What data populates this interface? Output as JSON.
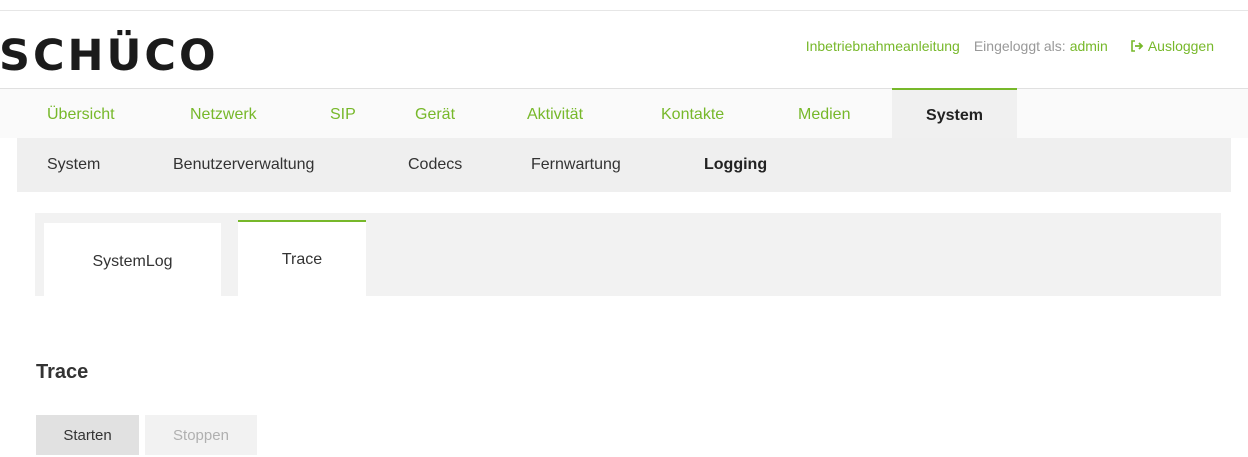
{
  "brand": {
    "logo_text": "SCHÜCO"
  },
  "header": {
    "guide_link": "Inbetriebnahmeanleitung",
    "logged_in_label": "Eingeloggt als:",
    "username": "admin",
    "logout_label": "Ausloggen",
    "logout_icon": "sign-out-icon"
  },
  "mainnav": {
    "items": [
      {
        "label": "Übersicht"
      },
      {
        "label": "Netzwerk"
      },
      {
        "label": "SIP"
      },
      {
        "label": "Gerät"
      },
      {
        "label": "Aktivität"
      },
      {
        "label": "Kontakte"
      },
      {
        "label": "Medien"
      },
      {
        "label": "System",
        "active": true
      }
    ]
  },
  "subnav": {
    "items": [
      {
        "label": "System"
      },
      {
        "label": "Benutzerverwaltung"
      },
      {
        "label": "Codecs"
      },
      {
        "label": "Fernwartung"
      },
      {
        "label": "Logging",
        "active": true
      }
    ]
  },
  "tabs": [
    {
      "label": "SystemLog"
    },
    {
      "label": "Trace",
      "active": true
    }
  ],
  "section": {
    "title": "Trace"
  },
  "actions": {
    "start_label": "Starten",
    "stop_label": "Stoppen",
    "stop_disabled": true
  },
  "colors": {
    "accent": "#77b82a",
    "text": "#333333",
    "muted": "#999999"
  }
}
